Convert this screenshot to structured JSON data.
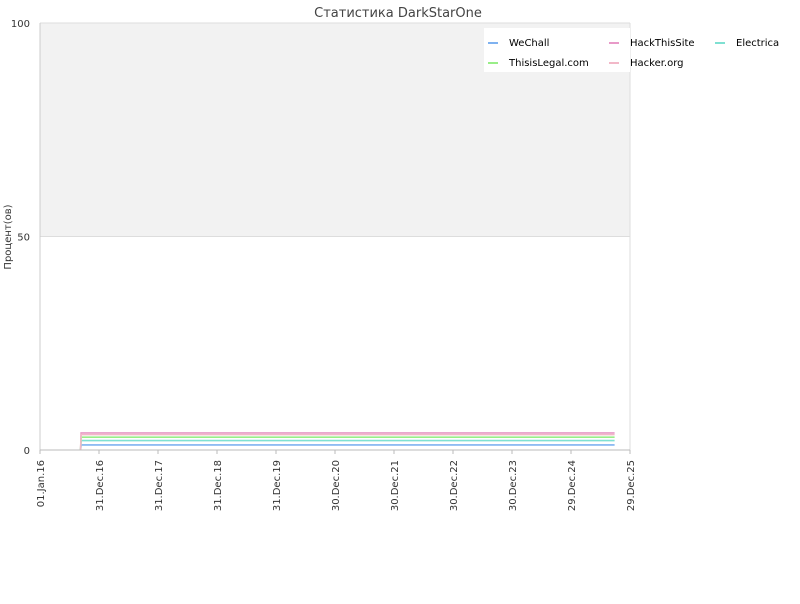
{
  "chart_data": {
    "type": "line",
    "title": "Статистика DarkStarOne",
    "ylabel": "Процент(ов)",
    "xlabel": "",
    "ylim": [
      0,
      100
    ],
    "y_ticks": [
      0,
      50,
      100
    ],
    "x_ticks": [
      "01.Jan.16",
      "31.Dec.16",
      "31.Dec.17",
      "31.Dec.18",
      "31.Dec.19",
      "30.Dec.20",
      "30.Dec.21",
      "30.Dec.22",
      "30.Dec.23",
      "29.Dec.24",
      "29.Dec.25"
    ],
    "x": [
      "08.Sep.16",
      "11.Sep.16",
      "25.Sep.25"
    ],
    "series": [
      {
        "name": "WeChall",
        "color": "#7fb2f0",
        "values": [
          0,
          1.2,
          1.2
        ]
      },
      {
        "name": "HackThisSite",
        "color": "#e89ac8",
        "values": [
          0,
          4,
          4
        ]
      },
      {
        "name": "Electrica",
        "color": "#7fe0d2",
        "values": [
          0,
          2.2,
          2.2
        ]
      },
      {
        "name": "ThisisLegal.com",
        "color": "#99ee88",
        "values": [
          0,
          3,
          3
        ]
      },
      {
        "name": "Hacker.org",
        "color": "#f2b8c8",
        "values": [
          0,
          3.6,
          3.6
        ]
      }
    ],
    "legend_position": "top-right",
    "bands": [
      {
        "from": 50,
        "to": 100,
        "color": "#f2f2f2"
      }
    ],
    "grid": true
  }
}
